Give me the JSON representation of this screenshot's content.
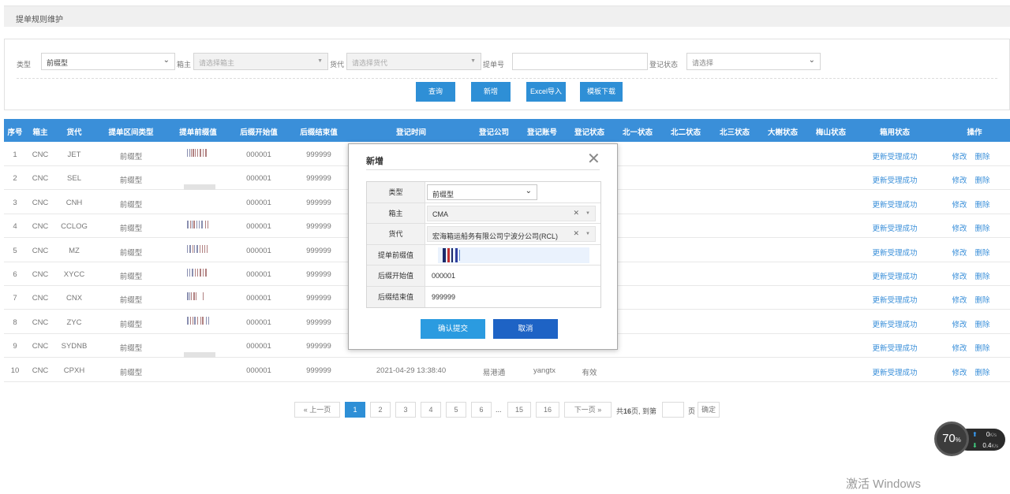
{
  "page_title": "提单规则维护",
  "filters": {
    "type_label": "类型",
    "type_value": "前缀型",
    "carrier_label": "箱主",
    "carrier_placeholder": "请选择箱主",
    "agent_label": "货代",
    "agent_placeholder": "请选择货代",
    "bl_label": "提单号",
    "bl_value": "",
    "status_label": "登记状态",
    "status_placeholder": "请选择"
  },
  "buttons": {
    "query": "查询",
    "add": "新增",
    "excel_import": "Excel导入",
    "template_download": "模板下载"
  },
  "table": {
    "headers": [
      "序号",
      "箱主",
      "货代",
      "提单区间类型",
      "提单前缀值",
      "后缀开始值",
      "后缀结束值",
      "登记时间",
      "登记公司",
      "登记账号",
      "登记状态",
      "北一状态",
      "北二状态",
      "北三状态",
      "大榭状态",
      "梅山状态",
      "箱用状态",
      "操作"
    ],
    "rows": [
      {
        "no": "1",
        "carrier": "CNC",
        "agent": "JET",
        "type": "前缀型",
        "start": "000001",
        "end": "999999",
        "status": "更新受理成功",
        "edit": "修改",
        "del": "删除"
      },
      {
        "no": "2",
        "carrier": "CNC",
        "agent": "SEL",
        "type": "前缀型",
        "start": "000001",
        "end": "999999",
        "status": "更新受理成功",
        "edit": "修改",
        "del": "删除"
      },
      {
        "no": "3",
        "carrier": "CNC",
        "agent": "CNH",
        "type": "前缀型",
        "start": "000001",
        "end": "999999",
        "status": "更新受理成功",
        "edit": "修改",
        "del": "删除"
      },
      {
        "no": "4",
        "carrier": "CNC",
        "agent": "CCLOG",
        "type": "前缀型",
        "start": "000001",
        "end": "999999",
        "status": "更新受理成功",
        "edit": "修改",
        "del": "删除"
      },
      {
        "no": "5",
        "carrier": "CNC",
        "agent": "MZ",
        "type": "前缀型",
        "start": "000001",
        "end": "999999",
        "status": "更新受理成功",
        "edit": "修改",
        "del": "删除"
      },
      {
        "no": "6",
        "carrier": "CNC",
        "agent": "XYCC",
        "type": "前缀型",
        "start": "000001",
        "end": "999999",
        "status": "更新受理成功",
        "edit": "修改",
        "del": "删除"
      },
      {
        "no": "7",
        "carrier": "CNC",
        "agent": "CNX",
        "type": "前缀型",
        "start": "000001",
        "end": "999999",
        "status": "更新受理成功",
        "edit": "修改",
        "del": "删除"
      },
      {
        "no": "8",
        "carrier": "CNC",
        "agent": "ZYC",
        "type": "前缀型",
        "start": "000001",
        "end": "999999",
        "status": "更新受理成功",
        "edit": "修改",
        "del": "删除"
      },
      {
        "no": "9",
        "carrier": "CNC",
        "agent": "SYDNB",
        "type": "前缀型",
        "start": "000001",
        "end": "999999",
        "status": "更新受理成功",
        "edit": "修改",
        "del": "删除"
      },
      {
        "no": "10",
        "carrier": "CNC",
        "agent": "CPXH",
        "type": "前缀型",
        "start": "000001",
        "end": "999999",
        "time": "2021-04-29 13:38:40",
        "company": "易港通",
        "account": "yangtx",
        "reg_status": "有效",
        "status": "更新受理成功",
        "edit": "修改",
        "del": "删除"
      }
    ]
  },
  "pagination": {
    "prev": "« 上一页",
    "pages": [
      "1",
      "2",
      "3",
      "4",
      "5",
      "6",
      "...",
      "15",
      "16"
    ],
    "next": "下一页 »",
    "total_prefix": "共",
    "total_pages": "16",
    "total_suffix": "页,  到第",
    "page_suffix": "页",
    "confirm": "确定"
  },
  "modal": {
    "title": "新增",
    "type_label": "类型",
    "type_value": "前缀型",
    "carrier_label": "箱主",
    "carrier_value": "CMA",
    "agent_label": "货代",
    "agent_value": "宏海箱运船务有限公司宁波分公司(RCL)",
    "prefix_label": "提单前缀值",
    "start_label": "后缀开始值",
    "start_value": "000001",
    "end_label": "后缀结束值",
    "end_value": "999999",
    "submit": "确认提交",
    "cancel": "取消"
  },
  "speed_widget": {
    "percent": "70",
    "percent_unit": "%",
    "up": "0",
    "down": "0.4",
    "unit": "K/s"
  },
  "watermark": "激活 Windows",
  "colors": {
    "header_blue": "#3a8fd9",
    "button_blue": "#2e8fd6",
    "modal_submit": "#2b9be0",
    "modal_cancel": "#1e63c5"
  }
}
